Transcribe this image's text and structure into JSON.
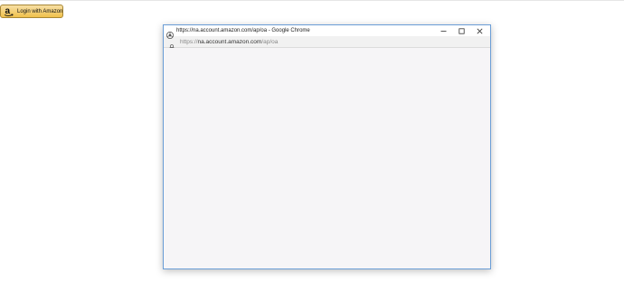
{
  "login_button": {
    "label": "Login with Amazon",
    "icon": "amazon-logo-icon",
    "colors": {
      "top": "#f7dfa5",
      "bottom": "#f0c14b",
      "border": "#a88734"
    }
  },
  "popup": {
    "window_title": "https://na.account.amazon.com/ap/oa - Google Chrome",
    "title_icon": "chrome-icon",
    "address": {
      "scheme": "https://",
      "host": "na.account.amazon.com",
      "path": "/ap/oa",
      "icon": "lock-icon"
    },
    "controls": {
      "minimize_icon": "minimize-icon",
      "maximize_icon": "maximize-icon",
      "close_icon": "close-icon"
    },
    "border_color": "#6a9dd6",
    "content_background": "#f6f5f7"
  }
}
